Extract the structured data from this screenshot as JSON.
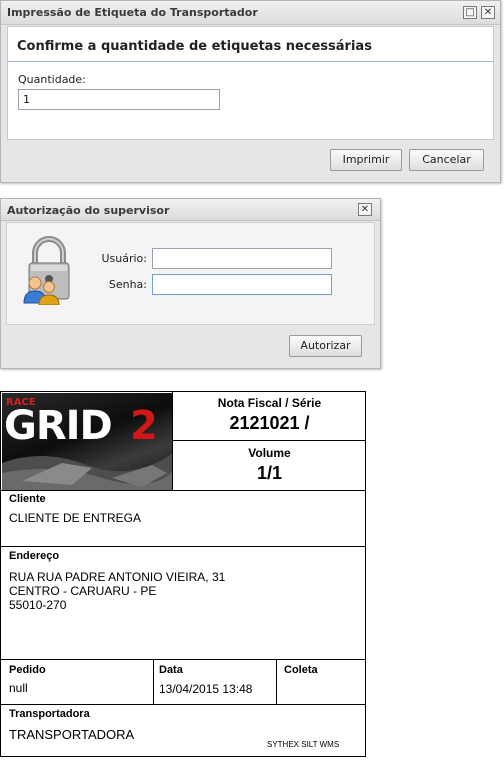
{
  "dialog1": {
    "title": "Impressão de Etiqueta do Transportador",
    "heading": "Confirme a quantidade de etiquetas necessárias",
    "quantity_label": "Quantidade:",
    "quantity_value": "1",
    "print_label": "Imprimir",
    "cancel_label": "Cancelar",
    "maximize_glyph": "□",
    "close_glyph": "✕"
  },
  "dialog2": {
    "title": "Autorização do supervisor",
    "user_label": "Usuário:",
    "user_value": "",
    "password_label": "Senha:",
    "password_value": "",
    "authorize_label": "Autorizar",
    "close_glyph": "✕",
    "icon": "lock-users-icon"
  },
  "shipping_label": {
    "logo_text": "GRID2",
    "logo_small": "GRID",
    "nf_title": "Nota Fiscal / Série",
    "nf_value": "2121021 /",
    "volume_title": "Volume",
    "volume_value": "1/1",
    "client_title": "Cliente",
    "client_value": "CLIENTE DE ENTREGA",
    "address_title": "Endereço",
    "address_line1": "RUA RUA PADRE ANTONIO VIEIRA, 31",
    "address_line2": "CENTRO - CARUARU - PE",
    "address_line3": "55010-270",
    "order_title": "Pedido",
    "order_value": "null",
    "date_title": "Data",
    "date_value": "13/04/2015 13:48",
    "pickup_title": "Coleta",
    "pickup_value": "",
    "carrier_title": "Transportadora",
    "carrier_value": "TRANSPORTADORA",
    "footer": "SYTHEX SILT WMS"
  }
}
